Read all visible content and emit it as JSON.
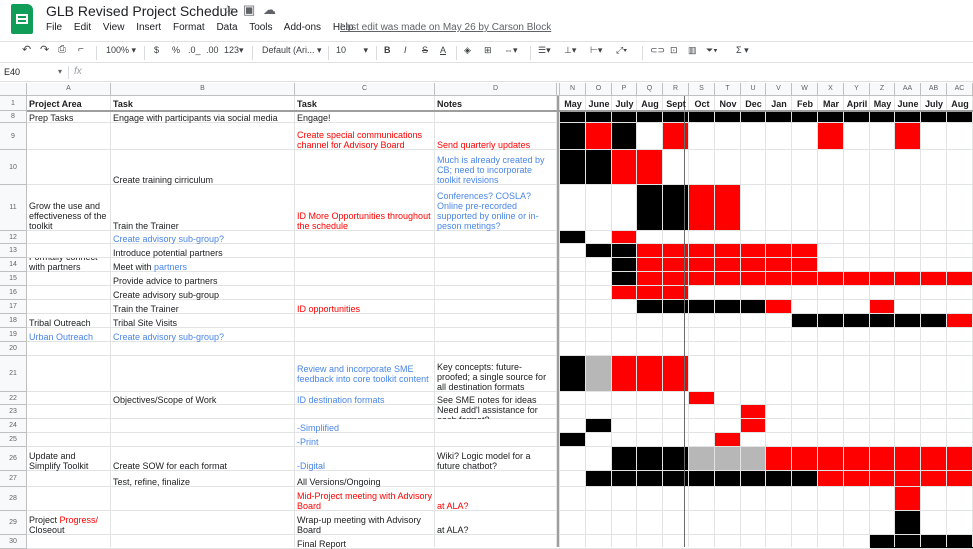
{
  "app": {
    "title": "GLB Revised Project Schedule",
    "menus": [
      "File",
      "Edit",
      "View",
      "Insert",
      "Format",
      "Data",
      "Tools",
      "Add-ons",
      "Help"
    ],
    "last_edit": "Last edit was made on May 26 by Carson Block"
  },
  "toolbar": {
    "zoom": "100%",
    "currency": "$",
    "percent": "%",
    "dec_less": ".0_",
    "dec_more": ".00",
    "number_format": "123",
    "font": "Default (Ari...",
    "font_size": "10",
    "bold": "B",
    "italic": "I",
    "strike": "S",
    "text_color": "A"
  },
  "formula_bar": {
    "cell_ref": "E40",
    "fx": "fx",
    "value": ""
  },
  "columns": [
    "A",
    "B",
    "C",
    "D",
    "E",
    "N",
    "O",
    "P",
    "Q",
    "R",
    "S",
    "T",
    "U",
    "V",
    "W",
    "X",
    "Y",
    "Z",
    "AA",
    "AB",
    "AC"
  ],
  "header_row": {
    "row": "1",
    "a": "Project Area",
    "b": "Task",
    "c": "Task",
    "d": "Notes",
    "months": [
      "May",
      "June",
      "July",
      "Aug",
      "Sept",
      "Oct",
      "Nov",
      "Dec",
      "Jan",
      "Feb",
      "Mar",
      "April",
      "May",
      "June",
      "July",
      "Aug"
    ]
  },
  "rows": [
    {
      "n": "8",
      "a": "Prep Tasks",
      "b": "Engage with participants via social media",
      "c": "Engage!",
      "d": ""
    },
    {
      "n": "9",
      "a": "",
      "b": "",
      "c": "Create special communications channel for Advisory Board",
      "d": "Send quarterly updates"
    },
    {
      "n": "10",
      "a": "",
      "b": "Create training cirriculum",
      "c": "",
      "d": "Much is already created by CB; need to incorporate toolkit revisions"
    },
    {
      "n": "11",
      "a": "Grow the use and effectiveness of the toolkit",
      "b": "Train the Trainer",
      "c": "ID More Opportunities throughout the schedule",
      "d": "Conferences? COSLA? Online pre-recorded supported by online or in-peson metings?"
    },
    {
      "n": "12",
      "a": "",
      "b": "Create advisory sub-group?",
      "c": "",
      "d": ""
    },
    {
      "n": "13",
      "a": "",
      "b": "Introduce potential partners",
      "c": "",
      "d": ""
    },
    {
      "n": "14",
      "a": "Formally connect with partners",
      "b_pre": "Meet with ",
      "b_post": "partners",
      "c": "",
      "d": ""
    },
    {
      "n": "15",
      "a": "",
      "b": "Provide advice to partners",
      "c": "",
      "d": ""
    },
    {
      "n": "16",
      "a": "",
      "b": "Create advisory sub-group",
      "c": "",
      "d": ""
    },
    {
      "n": "17",
      "a": "",
      "b": "Train the Trainer",
      "c": "ID opportunities",
      "d": ""
    },
    {
      "n": "18",
      "a": "Tribal Outreach",
      "b": "Tribal Site Visits",
      "c": "",
      "d": ""
    },
    {
      "n": "19",
      "a": "Urban Outreach",
      "b": "Create advisory sub-group?",
      "c": "",
      "d": ""
    },
    {
      "n": "20",
      "a": "",
      "b": "",
      "c": "",
      "d": ""
    },
    {
      "n": "21",
      "a": "",
      "b": "",
      "c": "Review and incorporate SME feedback into core toolkit content",
      "d": "Key concepts: future-proofed; a single source for all destination formats"
    },
    {
      "n": "22",
      "a": "",
      "b": "Objectives/Scope of Work",
      "c": "ID destination formats",
      "d": "See SME notes for ideas"
    },
    {
      "n": "23",
      "a": "",
      "b": "",
      "c": "",
      "d": "Need add'l assistance for each format?"
    },
    {
      "n": "24",
      "a": "",
      "b": "",
      "c": "-Simplified",
      "d": ""
    },
    {
      "n": "25",
      "a": "",
      "b": "",
      "c": "-Print",
      "d": ""
    },
    {
      "n": "26",
      "a": "Update and Simplify Toolkit",
      "b": "Create SOW for each format",
      "c": "-Digital",
      "d": "Wiki? Logic model for a future chatbot?"
    },
    {
      "n": "27",
      "a": "",
      "b": "Test, refine, finalize",
      "c": "All Versions/Ongoing",
      "d": ""
    },
    {
      "n": "28",
      "a": "",
      "b": "",
      "c": "Mid-Project meeting with Advisory Board",
      "d": "at ALA?"
    },
    {
      "n": "29",
      "a_pre": "Project ",
      "a_mid": "Progress/",
      "a_post": "Closeout",
      "b": "",
      "c": "Wrap-up meeting with Advisory Board",
      "d": "at ALA?"
    },
    {
      "n": "30",
      "a": "",
      "b": "",
      "c": "Final Report",
      "d": ""
    }
  ],
  "colors": {
    "red": "#ff0000",
    "black": "#000000",
    "grey": "#b7b7b7",
    "link_blue": "#4a86e8",
    "sheets_green": "#0f9d58"
  },
  "icons": [
    "undo-icon",
    "redo-icon",
    "print-icon",
    "paint-format-icon",
    "star-icon",
    "move-folder-icon",
    "cloud-status-icon",
    "link-icon",
    "comment-icon",
    "chart-icon",
    "filter-icon",
    "function-icon"
  ],
  "gantt": {
    "8": [
      "k",
      "k",
      "k",
      "k",
      "k",
      "k",
      "k",
      "k",
      "k",
      "k",
      "k",
      "k",
      "k",
      "k",
      "k",
      "k"
    ],
    "9": [
      "k",
      "r",
      "k",
      "w",
      "r",
      "w",
      "w",
      "w",
      "w",
      "w",
      "r",
      "w",
      "w",
      "r",
      "w",
      "w"
    ],
    "10": [
      "k",
      "k",
      "r",
      "r",
      "w",
      "w",
      "w",
      "w",
      "w",
      "w",
      "w",
      "w",
      "w",
      "w",
      "w",
      "w"
    ],
    "11": [
      "w",
      "w",
      "w",
      "k",
      "k",
      "r",
      "r",
      "w",
      "w",
      "w",
      "w",
      "w",
      "w",
      "w",
      "w",
      "w"
    ],
    "12": [
      "k",
      "w",
      "r",
      "w",
      "w",
      "w",
      "w",
      "w",
      "w",
      "w",
      "w",
      "w",
      "w",
      "w",
      "w",
      "w"
    ],
    "13": [
      "w",
      "k",
      "k",
      "r",
      "r",
      "r",
      "r",
      "r",
      "r",
      "r",
      "w",
      "w",
      "w",
      "w",
      "w",
      "w"
    ],
    "14": [
      "w",
      "w",
      "k",
      "r",
      "r",
      "r",
      "r",
      "r",
      "r",
      "r",
      "w",
      "w",
      "w",
      "w",
      "w",
      "w"
    ],
    "15": [
      "w",
      "w",
      "k",
      "r",
      "r",
      "r",
      "r",
      "r",
      "r",
      "r",
      "r",
      "r",
      "r",
      "r",
      "r",
      "r"
    ],
    "16": [
      "w",
      "w",
      "r",
      "r",
      "r",
      "w",
      "w",
      "w",
      "w",
      "w",
      "w",
      "w",
      "w",
      "w",
      "w",
      "w"
    ],
    "17": [
      "w",
      "w",
      "w",
      "k",
      "k",
      "k",
      "k",
      "k",
      "r",
      "w",
      "w",
      "w",
      "r",
      "w",
      "w",
      "w"
    ],
    "18": [
      "w",
      "w",
      "w",
      "w",
      "w",
      "w",
      "w",
      "w",
      "w",
      "k",
      "k",
      "k",
      "k",
      "k",
      "k",
      "r"
    ],
    "19": [
      "w",
      "w",
      "w",
      "w",
      "w",
      "w",
      "w",
      "w",
      "w",
      "w",
      "w",
      "w",
      "w",
      "w",
      "w",
      "w"
    ],
    "20": [
      "w",
      "w",
      "w",
      "w",
      "w",
      "w",
      "w",
      "w",
      "w",
      "w",
      "w",
      "w",
      "w",
      "w",
      "w",
      "w"
    ],
    "21": [
      "k",
      "g",
      "r",
      "r",
      "r",
      "w",
      "w",
      "w",
      "w",
      "w",
      "w",
      "w",
      "w",
      "w",
      "w",
      "w"
    ],
    "22": [
      "w",
      "w",
      "w",
      "w",
      "w",
      "r",
      "w",
      "w",
      "w",
      "w",
      "w",
      "w",
      "w",
      "w",
      "w",
      "w"
    ],
    "23": [
      "w",
      "w",
      "w",
      "w",
      "w",
      "w",
      "w",
      "r",
      "w",
      "w",
      "w",
      "w",
      "w",
      "w",
      "w",
      "w"
    ],
    "24": [
      "w",
      "k",
      "w",
      "w",
      "w",
      "w",
      "w",
      "r",
      "w",
      "w",
      "w",
      "w",
      "w",
      "w",
      "w",
      "w"
    ],
    "25": [
      "k",
      "w",
      "w",
      "w",
      "w",
      "w",
      "r",
      "w",
      "w",
      "w",
      "w",
      "w",
      "w",
      "w",
      "w",
      "w"
    ],
    "26": [
      "w",
      "w",
      "k",
      "k",
      "k",
      "g",
      "g",
      "g",
      "r",
      "r",
      "r",
      "r",
      "r",
      "r",
      "r",
      "r"
    ],
    "27": [
      "w",
      "k",
      "k",
      "k",
      "k",
      "k",
      "k",
      "k",
      "k",
      "k",
      "r",
      "r",
      "r",
      "r",
      "r",
      "r"
    ],
    "28": [
      "w",
      "w",
      "w",
      "w",
      "w",
      "w",
      "w",
      "w",
      "w",
      "w",
      "w",
      "w",
      "w",
      "r",
      "w",
      "w"
    ],
    "29": [
      "w",
      "w",
      "w",
      "w",
      "w",
      "w",
      "w",
      "w",
      "w",
      "w",
      "w",
      "w",
      "w",
      "k",
      "w",
      "w"
    ],
    "30": [
      "w",
      "w",
      "w",
      "w",
      "w",
      "w",
      "w",
      "w",
      "w",
      "w",
      "w",
      "w",
      "k",
      "k",
      "k",
      "k"
    ]
  }
}
